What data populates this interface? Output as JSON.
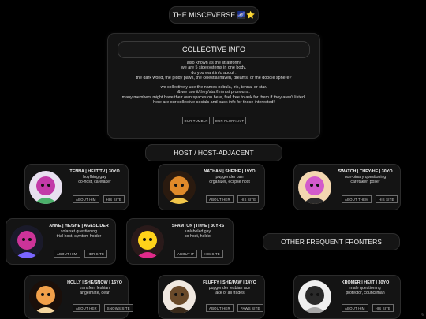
{
  "header": {
    "title": "THE MISCEVERSE 🌌⭐"
  },
  "info": {
    "heading": "COLLECTIVE INFO",
    "lines1": [
      "also known as the stratiform!",
      "we are 5 sidesystems in one body.",
      "do you want info about :",
      "the dark world, the piddy paws, the celestial haven, dreams, or the doodle sphere?"
    ],
    "lines2": [
      "we collectively use the names nebula, iris, tenna, or star.",
      "& we use it/they/star/hr/mist pronouns.",
      "many members might have their own spaces on here, feel free to ask for them if they aren't listed!",
      "here are our collective socials and pack info for those interested!"
    ],
    "buttons": [
      "OUR TUMBLR",
      "OUR PLURALKIT"
    ]
  },
  "sections": {
    "host": "HOST / HOST-ADJACENT",
    "other": "OTHER FREQUENT FRONTERS"
  },
  "cards": [
    {
      "name": "TENNA | HE/IT/TV | 30YO",
      "desc": [
        "boyfhing gay",
        "co-host, caretaker"
      ],
      "buttons": [
        "ABOUT HIM",
        "HIS SITE"
      ],
      "colors": [
        "#e8e0f0",
        "#c23aa8",
        "#4bb06a"
      ]
    },
    {
      "name": "NATHAN | SHE/HE | 19YO",
      "desc": [
        "pupgender pan",
        "organizer, eclipse host"
      ],
      "buttons": [
        "ABOUT HER",
        "HIS SITE"
      ],
      "colors": [
        "#2a1a0f",
        "#e08a2a",
        "#f2c64a"
      ]
    },
    {
      "name": "SWATCH | THEY/HE | 30YO",
      "desc": [
        "non-binary questioning",
        "caretaker, poser"
      ],
      "buttons": [
        "ABOUT THEM",
        "HIS SITE"
      ],
      "colors": [
        "#f3d6b0",
        "#d25acb",
        "#2a2a2a"
      ]
    },
    {
      "name": "ANNE | HE/SHE | AGESLIDER",
      "desc": [
        "solarset questioning",
        "trial host, symtom holder"
      ],
      "buttons": [
        "ABOUT HIM",
        "HER SITE"
      ],
      "colors": [
        "#1a1a2a",
        "#cc3399",
        "#7a66ff"
      ]
    },
    {
      "name": "SPAMTON | IT/HE | 30YRS",
      "desc": [
        "unlabeled gay",
        "co-host, holder"
      ],
      "buttons": [
        "ABOUT IT",
        "HIS SITE"
      ],
      "colors": [
        "#2a1a1a",
        "#ffd21a",
        "#e02a8a"
      ]
    },
    {
      "name": "HOLLY | SHE/SNOW | 16YO",
      "desc": [
        "transfem lesbian",
        "angelmate, dear"
      ],
      "buttons": [
        "ABOUT HER",
        "SNOWS SITE"
      ],
      "colors": [
        "#1a0f0a",
        "#f2a04a",
        "#f5d7a0"
      ]
    },
    {
      "name": "FLUFFY | SHE/PAW | 14YO",
      "desc": [
        "pupgender lesbian ace",
        "jack of all trades"
      ],
      "buttons": [
        "ABOUT HER",
        "PAWS SITE"
      ],
      "colors": [
        "#f0e8e0",
        "#6a4a2a",
        "#3a2a1a"
      ]
    },
    {
      "name": "KROMER | HE/IT | 30YO",
      "desc": [
        "male questioning",
        "protector, councilman"
      ],
      "buttons": [
        "ABOUT HIM",
        "HIS SITE"
      ],
      "colors": [
        "#f0f0f0",
        "#2a2a2a",
        "#a8a8a8"
      ]
    }
  ],
  "footer": {
    "icon": "©"
  }
}
